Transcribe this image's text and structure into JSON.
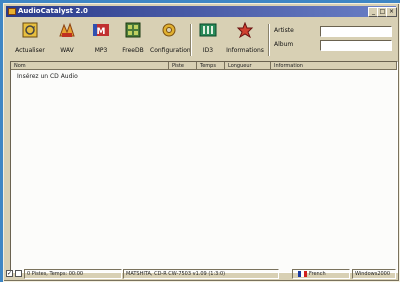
{
  "window": {
    "title": "AudioCatalyst 2.0"
  },
  "titlebar": {
    "minimize": "_",
    "maximize": "□",
    "close": "×"
  },
  "toolbar": {
    "buttons": [
      {
        "label": "Actualiser"
      },
      {
        "label": "WAV"
      },
      {
        "label": "MP3"
      },
      {
        "label": "FreeDB"
      },
      {
        "label": "Configuration"
      },
      {
        "label": "ID3"
      },
      {
        "label": "Informations"
      }
    ],
    "fields": {
      "artist_label": "Artiste",
      "artist_value": "",
      "album_label": "Album",
      "album_value": ""
    }
  },
  "list": {
    "columns": [
      "Nom",
      "Piste",
      "Temps",
      "Longueur",
      "Information"
    ],
    "rows": [
      "Insérez un CD Audio"
    ]
  },
  "status": {
    "summary": "0 Pistes, Temps: 00:00",
    "drive": "MATSHITA, CD-R   CW-7503   v1.09 (1:3:0)",
    "language": "French",
    "os": "Windows2000"
  },
  "colors": {
    "window_bg": "#d8d0b4",
    "desktop": "#3f86c4",
    "titlebar": "#2a3a8a"
  }
}
